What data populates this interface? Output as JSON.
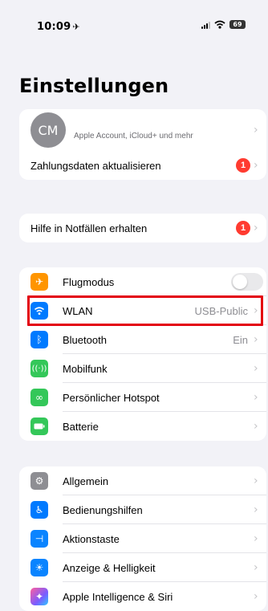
{
  "status_bar": {
    "time": "10:09",
    "battery": "69"
  },
  "page": {
    "title": "Einstellungen"
  },
  "account": {
    "initials": "CM",
    "subtitle": "Apple Account, iCloud+ und mehr"
  },
  "payment": {
    "label": "Zahlungsdaten aktualisieren",
    "badge": "1"
  },
  "emergency": {
    "label": "Hilfe in Notfällen erhalten",
    "badge": "1"
  },
  "connectivity": [
    {
      "label": "Flugmodus",
      "icon": "airplane-icon",
      "color": "#ff9500"
    },
    {
      "label": "WLAN",
      "value": "USB-Public",
      "icon": "wifi-icon",
      "color": "#007aff"
    },
    {
      "label": "Bluetooth",
      "value": "Ein",
      "icon": "bluetooth-icon",
      "color": "#007aff"
    },
    {
      "label": "Mobilfunk",
      "icon": "antenna-icon",
      "color": "#34c759"
    },
    {
      "label": "Persönlicher Hotspot",
      "icon": "hotspot-icon",
      "color": "#34c759"
    },
    {
      "label": "Batterie",
      "icon": "battery-icon",
      "color": "#34c759"
    }
  ],
  "general": [
    {
      "label": "Allgemein",
      "icon": "gear-icon",
      "color": "#8e8e93"
    },
    {
      "label": "Bedienungshilfen",
      "icon": "accessibility-icon",
      "color": "#007aff"
    },
    {
      "label": "Aktionstaste",
      "icon": "action-button-icon",
      "color": "#0a84ff"
    },
    {
      "label": "Anzeige & Helligkeit",
      "icon": "sun-icon",
      "color": "#0a84ff"
    },
    {
      "label": "Apple Intelligence & Siri",
      "icon": "siri-icon",
      "color": "#a05cf0"
    }
  ],
  "chevron": "›"
}
